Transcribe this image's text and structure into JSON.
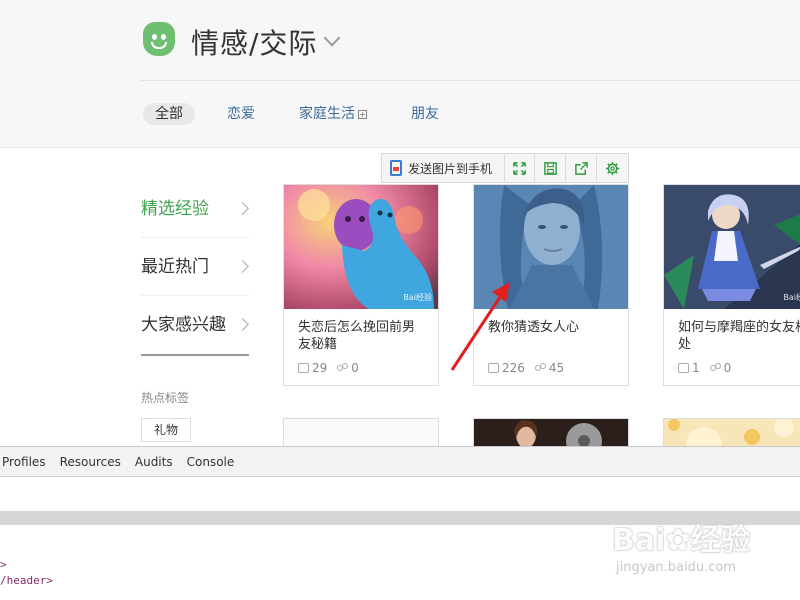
{
  "header": {
    "title": "情感/交际",
    "tabs": [
      {
        "label": "全部",
        "active": true
      },
      {
        "label": "恋爱"
      },
      {
        "label": "家庭生活",
        "has_expand": true,
        "expand_glyph": "+"
      },
      {
        "label": "朋友"
      }
    ]
  },
  "toolbar": {
    "send_label": "发送图片到手机",
    "icons": [
      "fullscreen-icon",
      "save-icon",
      "share-icon",
      "settings-icon"
    ],
    "accent": "#2e9a3c"
  },
  "sidebar": {
    "items": [
      {
        "label": "精选经验",
        "active": true
      },
      {
        "label": "最近热门"
      },
      {
        "label": "大家感兴趣"
      }
    ],
    "hot_title": "热点标签",
    "hot_tags": [
      "礼物"
    ]
  },
  "cards": [
    {
      "title": "失恋后怎么挽回前男友秘籍",
      "likes": "29",
      "shares": "0"
    },
    {
      "title": "教你猜透女人心",
      "likes": "226",
      "shares": "45"
    },
    {
      "title": "如何与摩羯座的女友相处",
      "likes": "1",
      "shares": "0"
    }
  ],
  "devtools": {
    "tabs": [
      "Profiles",
      "Resources",
      "Audits",
      "Console"
    ],
    "code_lines": [
      ">",
      "/header>"
    ]
  },
  "watermark": {
    "brand": "Bai",
    "brand_tail": "经验",
    "url": "jingyan.baidu.com"
  },
  "colors": {
    "brand_green": "#6fbf73",
    "active_green": "#3fa34d",
    "link_blue": "#3a6a9a",
    "arrow_red": "#e02020"
  }
}
